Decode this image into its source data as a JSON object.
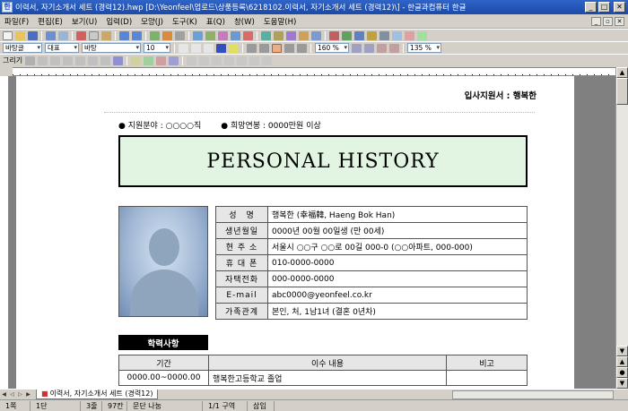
{
  "window": {
    "title": "이력서, 자기소개서 세트 (경력12).hwp [D:\\Yeonfeel\\업로드\\상품등록\\6218102.이력서, 자기소개서 세트 (경력12)\\] - 한글과컴퓨터 한글"
  },
  "menu": {
    "items": [
      "파일(F)",
      "편집(E)",
      "보기(U)",
      "입력(D)",
      "모양(J)",
      "도구(K)",
      "표(Q)",
      "창(W)",
      "도움말(H)"
    ]
  },
  "format_toolbar": {
    "style": "바탕글",
    "font_lang": "대표",
    "font": "바탕",
    "size": "10",
    "zoom_left": "160 %",
    "zoom_right": "135 %"
  },
  "draw_toolbar": {
    "label": "그리기"
  },
  "document": {
    "applicant": "입사지원서 : 행복한",
    "field_desc": "● 지원분야 : ○○○○직",
    "salary_desc": "● 희망연봉 : 0000만원 이상",
    "heading": "PERSONAL HISTORY",
    "info_rows": [
      {
        "label": "성　명",
        "value": "행복한 (幸福韓, Haeng Bok Han)"
      },
      {
        "label": "생년월일",
        "value": "0000년 00월 00일생 (만 00세)"
      },
      {
        "label": "현 주 소",
        "value": "서울시 ○○구 ○○로 00길 000-0 (○○아파트, 000-000)"
      },
      {
        "label": "휴 대 폰",
        "value": "010-0000-0000"
      },
      {
        "label": "자택전화",
        "value": "000-0000-0000"
      },
      {
        "label": "E-mail",
        "value": "abc0000@yeonfeel.co.kr"
      },
      {
        "label": "가족관계",
        "value": "본인, 처, 1남1녀 (결혼 0년차)"
      }
    ],
    "education_title": "학력사항",
    "education_headers": [
      "기간",
      "이수 내용",
      "비고"
    ],
    "education_rows": [
      {
        "period": "0000.00~0000.00",
        "content": "행복한고등학교 졸업",
        "note": ""
      }
    ]
  },
  "tab": {
    "label": "이력서, 자기소개서 세트 (경력12)"
  },
  "status": {
    "page": "1쪽",
    "section": "1단",
    "line": "3줄",
    "col": "97칸",
    "mode": "문단 나눔",
    "pages": "1/1 구역",
    "insert": "삽입"
  },
  "colors": {
    "title_bar": "#2f64c8",
    "heading_box": "#e2f5e2",
    "workspace": "#808080"
  }
}
